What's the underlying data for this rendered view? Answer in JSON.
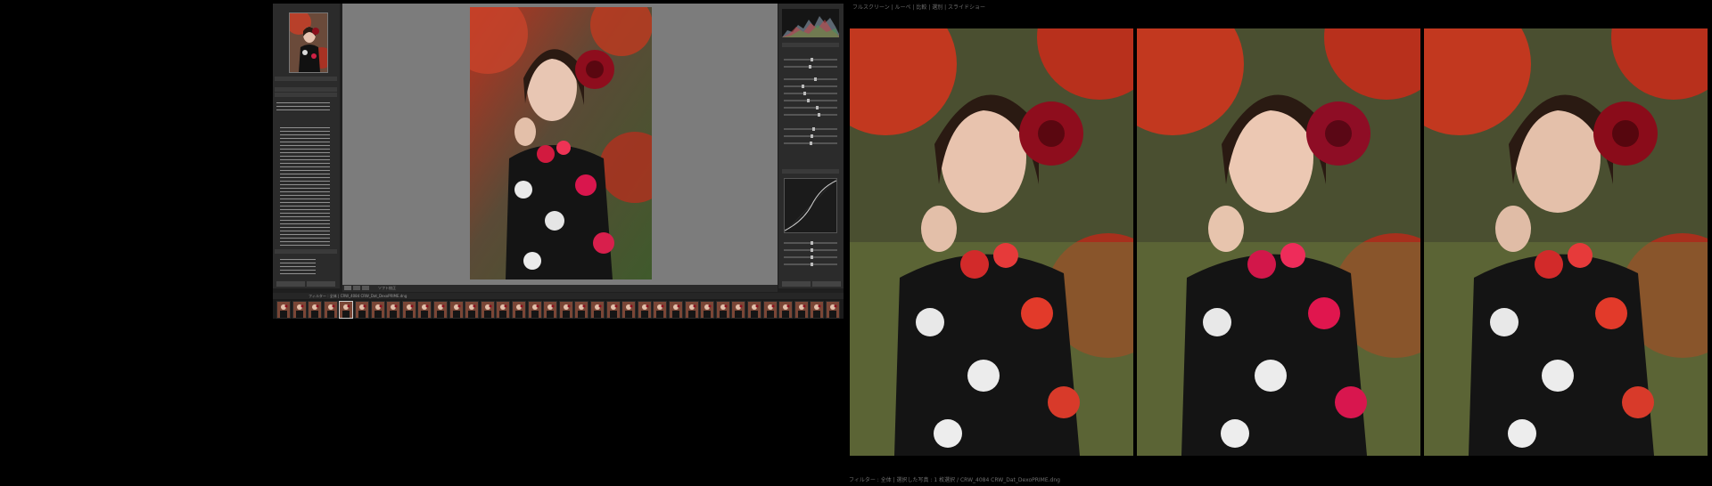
{
  "compare": {
    "status_text": "フルスクリーン | ルーペ | 比較 | 選別 | スライドショー",
    "footer_text": "フィルター : 全体 | 選択した写真 : 1 枚選択 / CRW_4084 CRW_Dat_DexoPRIME.dng"
  },
  "left_window": {
    "filmstrip_label": "フィルター : 全体 | CRW_4084 CRW_Dat_DexoPRIME.dng",
    "toolbar_label": "ソフト校正"
  },
  "colors": {
    "accent": "#c3263b",
    "panel": "#2b2b2b",
    "center_bg": "#7c7c7c"
  }
}
